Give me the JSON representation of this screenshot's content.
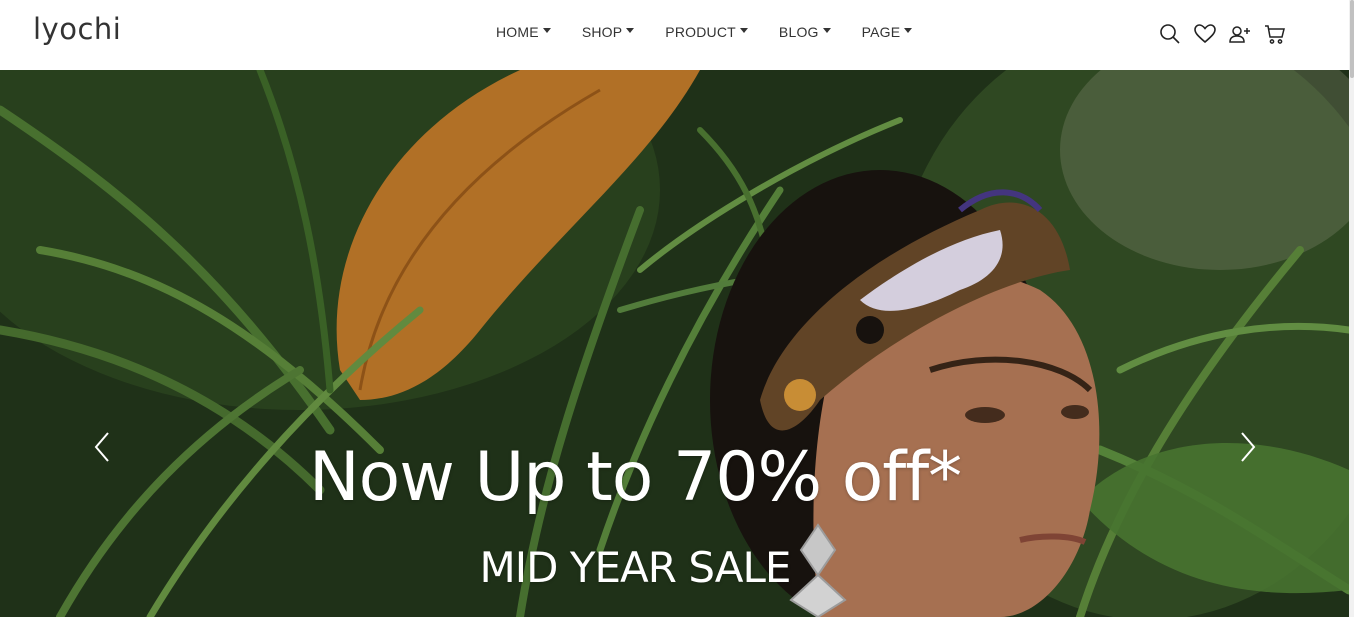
{
  "brand": {
    "logo_text": "lyochi"
  },
  "nav": {
    "items": [
      {
        "label": "HOME"
      },
      {
        "label": "SHOP"
      },
      {
        "label": "PRODUCT"
      },
      {
        "label": "BLOG"
      },
      {
        "label": "PAGE"
      }
    ]
  },
  "header_icons": [
    "search-icon",
    "heart-icon",
    "user-add-icon",
    "cart-icon"
  ],
  "hero": {
    "title": "Now Up to 70% off*",
    "subtitle": "MID YEAR SALE",
    "prev_icon": "chevron-left-icon",
    "next_icon": "chevron-right-icon"
  },
  "colors": {
    "text": "#333333",
    "hero_text": "#ffffff",
    "foliage": "#2e4a22"
  }
}
